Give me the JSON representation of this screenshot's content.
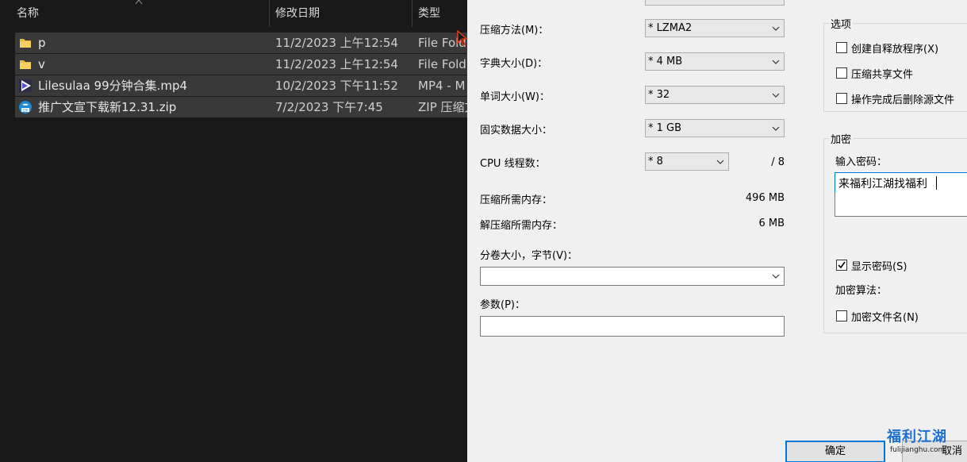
{
  "explorer": {
    "columns": {
      "name": "名称",
      "date": "修改日期",
      "type": "类型"
    },
    "files": [
      {
        "icon": "folder-icon",
        "name": "p",
        "date": "11/2/2023 上午12:54",
        "type": "File Fold"
      },
      {
        "icon": "folder-icon",
        "name": "v",
        "date": "11/2/2023 上午12:54",
        "type": "File Fold"
      },
      {
        "icon": "video-file-icon",
        "name": "Lilesulaa 99分钟合集.mp4",
        "date": "10/2/2023 下午11:52",
        "type": "MP4 - M"
      },
      {
        "icon": "zip-file-icon",
        "name": "推广文宣下载新12.31.zip",
        "date": "7/2/2023 下午7:45",
        "type": "ZIP 压缩文"
      }
    ]
  },
  "dialog": {
    "compression_method": {
      "label": "压缩方法(M)：",
      "value": "* LZMA2"
    },
    "dictionary_size": {
      "label": "字典大小(D)：",
      "value": "* 4 MB"
    },
    "word_size": {
      "label": "单词大小(W)：",
      "value": "* 32"
    },
    "solid_block_size": {
      "label": "固实数据大小：",
      "value": "* 1 GB"
    },
    "cpu_threads": {
      "label": "CPU 线程数：",
      "value": "* 8",
      "max": "/ 8"
    },
    "memory_compress": {
      "label": "压缩所需内存：",
      "value": "496 MB"
    },
    "memory_decompress": {
      "label": "解压缩所需内存：",
      "value": "6 MB"
    },
    "split_volumes": {
      "label": "分卷大小，字节(V)：",
      "value": ""
    },
    "parameters": {
      "label": "参数(P)：",
      "value": ""
    },
    "options": {
      "title": "选项",
      "create_sfx": "创建自释放程序(X)",
      "compress_shared": "压缩共享文件",
      "delete_after": "操作完成后删除源文件"
    },
    "encryption": {
      "title": "加密",
      "password_label": "输入密码：",
      "password_value": "来福利江湖找福利",
      "show_password": "显示密码(S)",
      "show_password_checked": true,
      "method_label": "加密算法：",
      "encrypt_names": "加密文件名(N)"
    },
    "buttons": {
      "ok": "确定",
      "cancel": "取消"
    }
  },
  "watermark": {
    "brand": "福利江湖",
    "url": "fulijianghu.com"
  }
}
